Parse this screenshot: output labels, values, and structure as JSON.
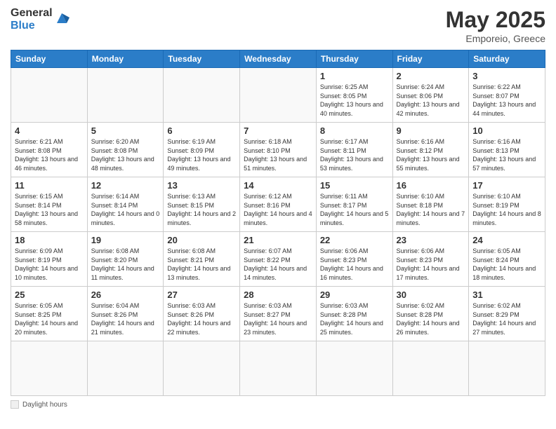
{
  "header": {
    "logo_general": "General",
    "logo_blue": "Blue",
    "month": "May 2025",
    "location": "Emporeio, Greece"
  },
  "weekdays": [
    "Sunday",
    "Monday",
    "Tuesday",
    "Wednesday",
    "Thursday",
    "Friday",
    "Saturday"
  ],
  "footer": {
    "label": "Daylight hours"
  },
  "days": [
    {
      "number": "",
      "sunrise": "",
      "sunset": "",
      "daylight": "",
      "empty": true
    },
    {
      "number": "",
      "sunrise": "",
      "sunset": "",
      "daylight": "",
      "empty": true
    },
    {
      "number": "",
      "sunrise": "",
      "sunset": "",
      "daylight": "",
      "empty": true
    },
    {
      "number": "",
      "sunrise": "",
      "sunset": "",
      "daylight": "",
      "empty": true
    },
    {
      "number": "1",
      "sunrise": "6:25 AM",
      "sunset": "8:05 PM",
      "daylight": "13 hours and 40 minutes."
    },
    {
      "number": "2",
      "sunrise": "6:24 AM",
      "sunset": "8:06 PM",
      "daylight": "13 hours and 42 minutes."
    },
    {
      "number": "3",
      "sunrise": "6:22 AM",
      "sunset": "8:07 PM",
      "daylight": "13 hours and 44 minutes."
    },
    {
      "number": "4",
      "sunrise": "6:21 AM",
      "sunset": "8:08 PM",
      "daylight": "13 hours and 46 minutes."
    },
    {
      "number": "5",
      "sunrise": "6:20 AM",
      "sunset": "8:08 PM",
      "daylight": "13 hours and 48 minutes."
    },
    {
      "number": "6",
      "sunrise": "6:19 AM",
      "sunset": "8:09 PM",
      "daylight": "13 hours and 49 minutes."
    },
    {
      "number": "7",
      "sunrise": "6:18 AM",
      "sunset": "8:10 PM",
      "daylight": "13 hours and 51 minutes."
    },
    {
      "number": "8",
      "sunrise": "6:17 AM",
      "sunset": "8:11 PM",
      "daylight": "13 hours and 53 minutes."
    },
    {
      "number": "9",
      "sunrise": "6:16 AM",
      "sunset": "8:12 PM",
      "daylight": "13 hours and 55 minutes."
    },
    {
      "number": "10",
      "sunrise": "6:16 AM",
      "sunset": "8:13 PM",
      "daylight": "13 hours and 57 minutes."
    },
    {
      "number": "11",
      "sunrise": "6:15 AM",
      "sunset": "8:14 PM",
      "daylight": "13 hours and 58 minutes."
    },
    {
      "number": "12",
      "sunrise": "6:14 AM",
      "sunset": "8:14 PM",
      "daylight": "14 hours and 0 minutes."
    },
    {
      "number": "13",
      "sunrise": "6:13 AM",
      "sunset": "8:15 PM",
      "daylight": "14 hours and 2 minutes."
    },
    {
      "number": "14",
      "sunrise": "6:12 AM",
      "sunset": "8:16 PM",
      "daylight": "14 hours and 4 minutes."
    },
    {
      "number": "15",
      "sunrise": "6:11 AM",
      "sunset": "8:17 PM",
      "daylight": "14 hours and 5 minutes."
    },
    {
      "number": "16",
      "sunrise": "6:10 AM",
      "sunset": "8:18 PM",
      "daylight": "14 hours and 7 minutes."
    },
    {
      "number": "17",
      "sunrise": "6:10 AM",
      "sunset": "8:19 PM",
      "daylight": "14 hours and 8 minutes."
    },
    {
      "number": "18",
      "sunrise": "6:09 AM",
      "sunset": "8:19 PM",
      "daylight": "14 hours and 10 minutes."
    },
    {
      "number": "19",
      "sunrise": "6:08 AM",
      "sunset": "8:20 PM",
      "daylight": "14 hours and 11 minutes."
    },
    {
      "number": "20",
      "sunrise": "6:08 AM",
      "sunset": "8:21 PM",
      "daylight": "14 hours and 13 minutes."
    },
    {
      "number": "21",
      "sunrise": "6:07 AM",
      "sunset": "8:22 PM",
      "daylight": "14 hours and 14 minutes."
    },
    {
      "number": "22",
      "sunrise": "6:06 AM",
      "sunset": "8:23 PM",
      "daylight": "14 hours and 16 minutes."
    },
    {
      "number": "23",
      "sunrise": "6:06 AM",
      "sunset": "8:23 PM",
      "daylight": "14 hours and 17 minutes."
    },
    {
      "number": "24",
      "sunrise": "6:05 AM",
      "sunset": "8:24 PM",
      "daylight": "14 hours and 18 minutes."
    },
    {
      "number": "25",
      "sunrise": "6:05 AM",
      "sunset": "8:25 PM",
      "daylight": "14 hours and 20 minutes."
    },
    {
      "number": "26",
      "sunrise": "6:04 AM",
      "sunset": "8:26 PM",
      "daylight": "14 hours and 21 minutes."
    },
    {
      "number": "27",
      "sunrise": "6:03 AM",
      "sunset": "8:26 PM",
      "daylight": "14 hours and 22 minutes."
    },
    {
      "number": "28",
      "sunrise": "6:03 AM",
      "sunset": "8:27 PM",
      "daylight": "14 hours and 23 minutes."
    },
    {
      "number": "29",
      "sunrise": "6:03 AM",
      "sunset": "8:28 PM",
      "daylight": "14 hours and 25 minutes."
    },
    {
      "number": "30",
      "sunrise": "6:02 AM",
      "sunset": "8:28 PM",
      "daylight": "14 hours and 26 minutes."
    },
    {
      "number": "31",
      "sunrise": "6:02 AM",
      "sunset": "8:29 PM",
      "daylight": "14 hours and 27 minutes."
    },
    {
      "number": "",
      "sunrise": "",
      "sunset": "",
      "daylight": "",
      "empty": true
    }
  ]
}
